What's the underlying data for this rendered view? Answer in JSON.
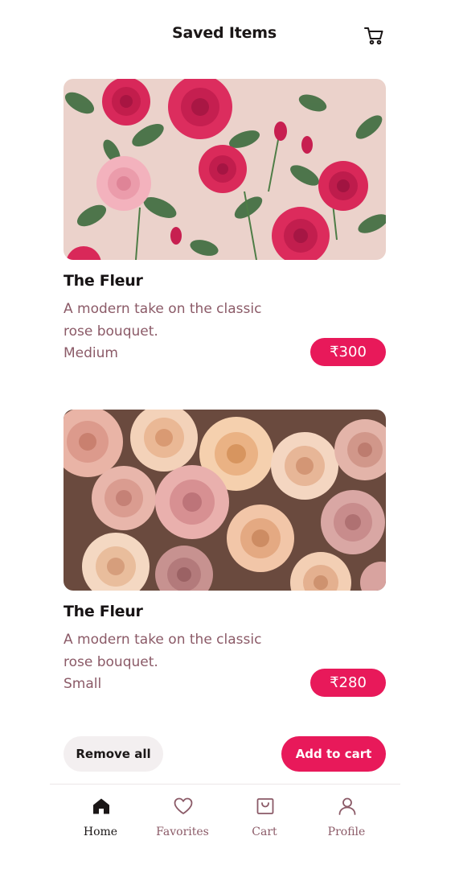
{
  "header": {
    "title": "Saved Items",
    "cart_icon": "cart-icon"
  },
  "items": [
    {
      "title": "The Fleur",
      "description": "A modern take on the classic rose bouquet.",
      "size": "Medium",
      "price": "₹300",
      "image": "red-and-pink-roses-pattern"
    },
    {
      "title": "The Fleur",
      "description": "A modern take on the classic rose bouquet.",
      "size": "Small",
      "price": "₹280",
      "image": "peach-and-dusty-pink-roses"
    }
  ],
  "actions": {
    "remove_all": "Remove all",
    "add_to_cart": "Add to cart"
  },
  "nav": [
    {
      "label": "Home",
      "icon": "home-icon",
      "active": true
    },
    {
      "label": "Favorites",
      "icon": "heart-icon",
      "active": false
    },
    {
      "label": "Cart",
      "icon": "bag-icon",
      "active": false
    },
    {
      "label": "Profile",
      "icon": "user-icon",
      "active": false
    }
  ],
  "colors": {
    "accent": "#e8195a",
    "muted_text": "#8b5a67",
    "secondary_button_bg": "#f3eff0"
  }
}
